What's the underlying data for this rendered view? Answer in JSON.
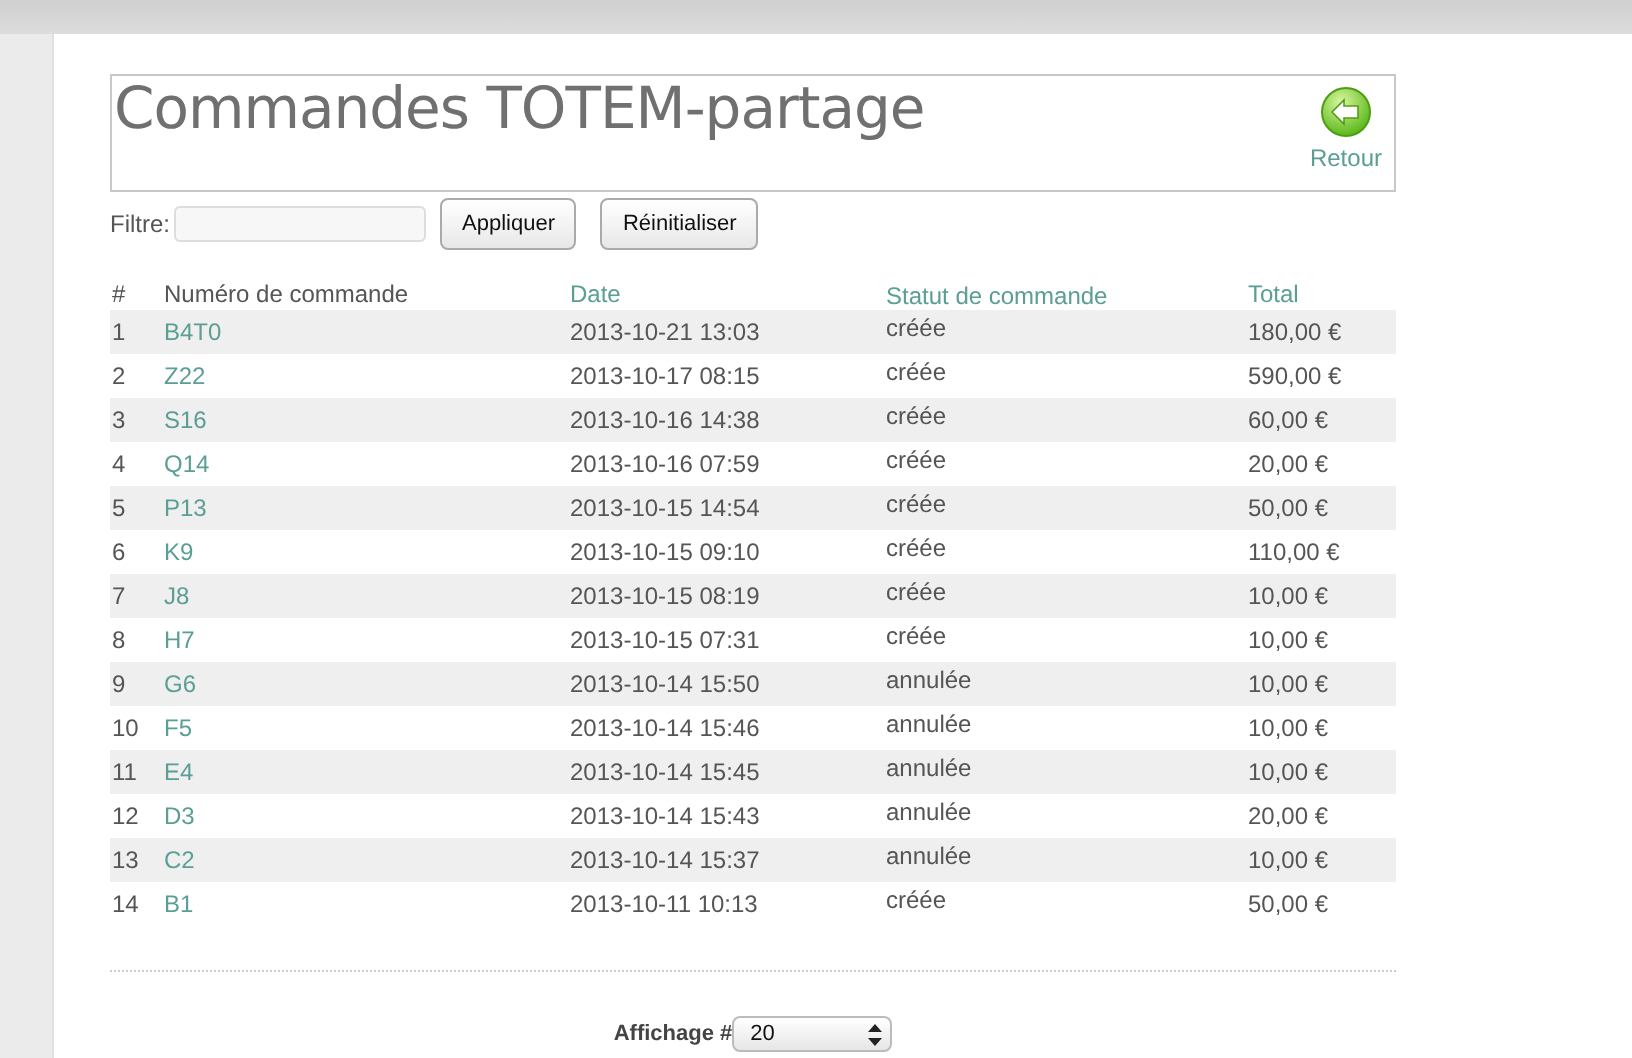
{
  "page": {
    "title": "Commandes TOTEM-partage",
    "back_link": "Retour"
  },
  "filter": {
    "label": "Filtre:",
    "buttons": [
      "Appliquer",
      "Réinitialiser"
    ]
  },
  "table": {
    "columns": [
      {
        "label": "#",
        "sortable": false
      },
      {
        "label": "Numéro de commande",
        "sortable": false
      },
      {
        "label": "Date",
        "sortable": true
      },
      {
        "label": "Statut de commande",
        "sortable": true
      },
      {
        "label": "Total",
        "sortable": true
      }
    ],
    "rows": [
      {
        "index": "1",
        "number": "B4T0",
        "date": "2013-10-21 13:03",
        "status": "créée",
        "total": "180,00 €"
      },
      {
        "index": "2",
        "number": "Z22",
        "date": "2013-10-17 08:15",
        "status": "créée",
        "total": "590,00 €"
      },
      {
        "index": "3",
        "number": "S16",
        "date": "2013-10-16 14:38",
        "status": "créée",
        "total": "60,00 €"
      },
      {
        "index": "4",
        "number": "Q14",
        "date": "2013-10-16 07:59",
        "status": "créée",
        "total": "20,00 €"
      },
      {
        "index": "5",
        "number": "P13",
        "date": "2013-10-15 14:54",
        "status": "créée",
        "total": "50,00 €"
      },
      {
        "index": "6",
        "number": "K9",
        "date": "2013-10-15 09:10",
        "status": "créée",
        "total": "110,00 €"
      },
      {
        "index": "7",
        "number": "J8",
        "date": "2013-10-15 08:19",
        "status": "créée",
        "total": "10,00 €"
      },
      {
        "index": "8",
        "number": "H7",
        "date": "2013-10-15 07:31",
        "status": "créée",
        "total": "10,00 €"
      },
      {
        "index": "9",
        "number": "G6",
        "date": "2013-10-14 15:50",
        "status": "annulée",
        "total": "10,00 €"
      },
      {
        "index": "10",
        "number": "F5",
        "date": "2013-10-14 15:46",
        "status": "annulée",
        "total": "10,00 €"
      },
      {
        "index": "11",
        "number": "E4",
        "date": "2013-10-14 15:45",
        "status": "annulée",
        "total": "10,00 €"
      },
      {
        "index": "12",
        "number": "D3",
        "date": "2013-10-14 15:43",
        "status": "annulée",
        "total": "20,00 €"
      },
      {
        "index": "13",
        "number": "C2",
        "date": "2013-10-14 15:37",
        "status": "annulée",
        "total": "10,00 €"
      },
      {
        "index": "14",
        "number": "B1",
        "date": "2013-10-11 10:13",
        "status": "créée",
        "total": "50,00 €"
      }
    ]
  },
  "pager": {
    "label": "Affichage #",
    "value": "20"
  }
}
